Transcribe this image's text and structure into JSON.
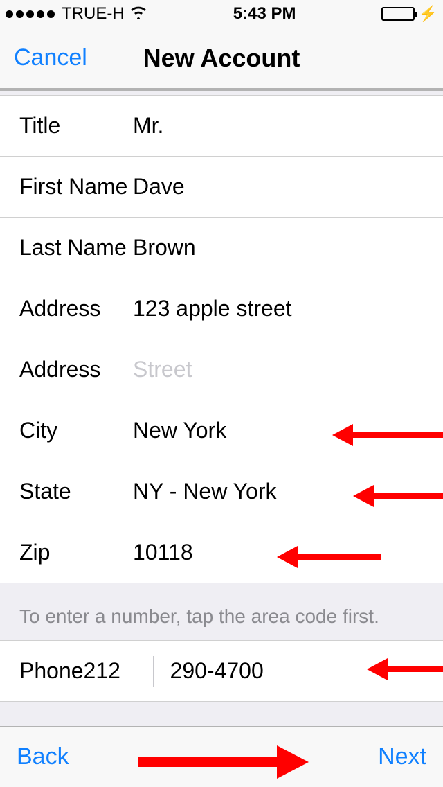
{
  "statusBar": {
    "carrier": "TRUE-H",
    "time": "5:43 PM"
  },
  "nav": {
    "cancel": "Cancel",
    "title": "New Account"
  },
  "form": {
    "titleLabel": "Title",
    "titleValue": "Mr.",
    "firstNameLabel": "First Name",
    "firstNameValue": "Dave",
    "lastNameLabel": "Last Name",
    "lastNameValue": "Brown",
    "address1Label": "Address",
    "address1Value": "123 apple street",
    "address2Label": "Address",
    "address2Placeholder": "Street",
    "cityLabel": "City",
    "cityValue": "New York",
    "stateLabel": "State",
    "stateValue": "NY - New York",
    "zipLabel": "Zip",
    "zipValue": "10118"
  },
  "phone": {
    "note": "To enter a number, tap the area code first.",
    "label": "Phone",
    "areaCode": "212",
    "number": "290-4700"
  },
  "footer": {
    "back": "Back",
    "next": "Next"
  }
}
